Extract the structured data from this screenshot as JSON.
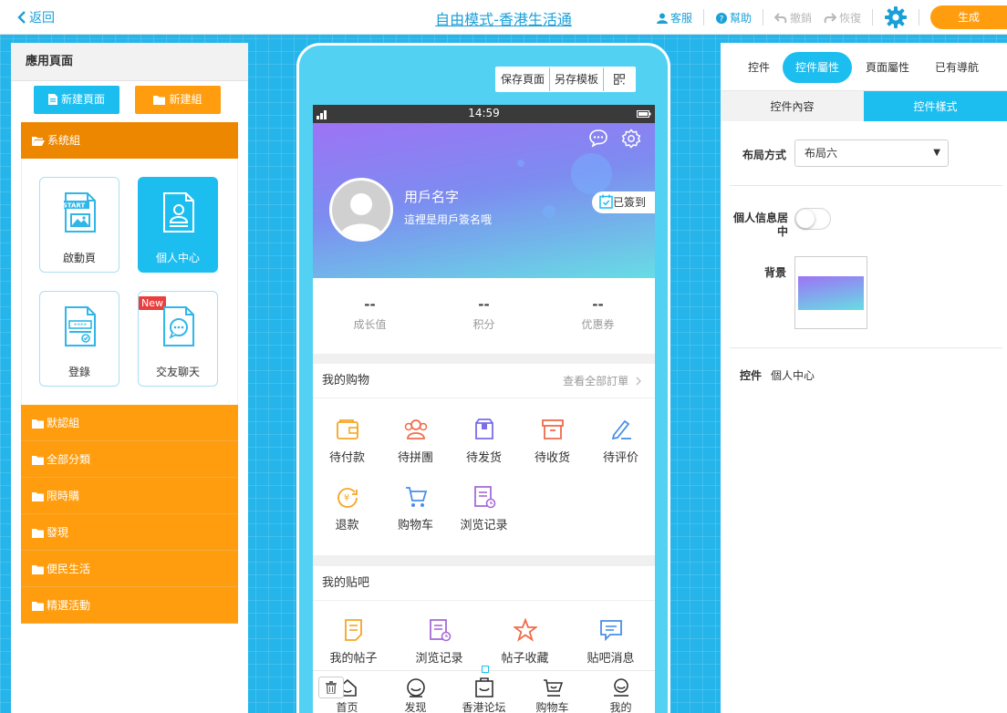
{
  "topbar": {
    "back_label": "返回",
    "title": "自由模式-香港生活通",
    "service_label": "客服",
    "help_label": "幫助",
    "undo_label": "撤銷",
    "redo_label": "恢復",
    "generate_label": "生成"
  },
  "left": {
    "title": "應用頁面",
    "new_page_label": "新建頁面",
    "new_group_label": "新建組",
    "system_group": "系统組",
    "cards": [
      {
        "label": "啟動頁",
        "icon": "start-page-icon"
      },
      {
        "label": "個人中心",
        "icon": "personal-center-icon",
        "active": true
      },
      {
        "label": "登錄",
        "icon": "login-icon"
      },
      {
        "label": "交友聊天",
        "icon": "chat-icon",
        "badge": "New"
      }
    ],
    "groups": [
      "默認組",
      "全部分類",
      "限時購",
      "發現",
      "便民生活",
      "精選活動"
    ]
  },
  "phone": {
    "tools": {
      "save": "保存頁面",
      "template": "另存模板"
    },
    "status_time": "14:59",
    "profile": {
      "name": "用戶名字",
      "signature": "這裡是用戶簽名哦",
      "checkin": "已簽到"
    },
    "stats": [
      {
        "value": "--",
        "label": "成长值"
      },
      {
        "value": "--",
        "label": "积分"
      },
      {
        "value": "--",
        "label": "优惠券"
      }
    ],
    "shopping": {
      "title": "我的购物",
      "more": "查看全部訂單",
      "items": [
        "待付款",
        "待拼團",
        "待发货",
        "待收货",
        "待评价",
        "退款",
        "购物车",
        "浏览记录"
      ]
    },
    "tieba": {
      "title": "我的贴吧",
      "items": [
        "我的帖子",
        "浏览记录",
        "帖子收藏",
        "贴吧消息"
      ]
    },
    "tabs": [
      "首页",
      "发现",
      "香港论坛",
      "购物车",
      "我的"
    ]
  },
  "right": {
    "tabs": [
      "控件",
      "控件屬性",
      "頁面屬性",
      "已有導航"
    ],
    "active_tab": "控件屬性",
    "subtabs": [
      "控件內容",
      "控件樣式"
    ],
    "active_subtab": "控件樣式",
    "layout_label": "布局方式",
    "layout_value": "布局六",
    "center_label": "個人信息居中",
    "center_on": false,
    "bg_label": "背景",
    "control_label": "控件",
    "control_value": "個人中心"
  },
  "colors": {
    "accent": "#1cbef0",
    "orange": "#ff9d0f",
    "orange_dark": "#ee8700",
    "canvas": "#25b5ea"
  }
}
